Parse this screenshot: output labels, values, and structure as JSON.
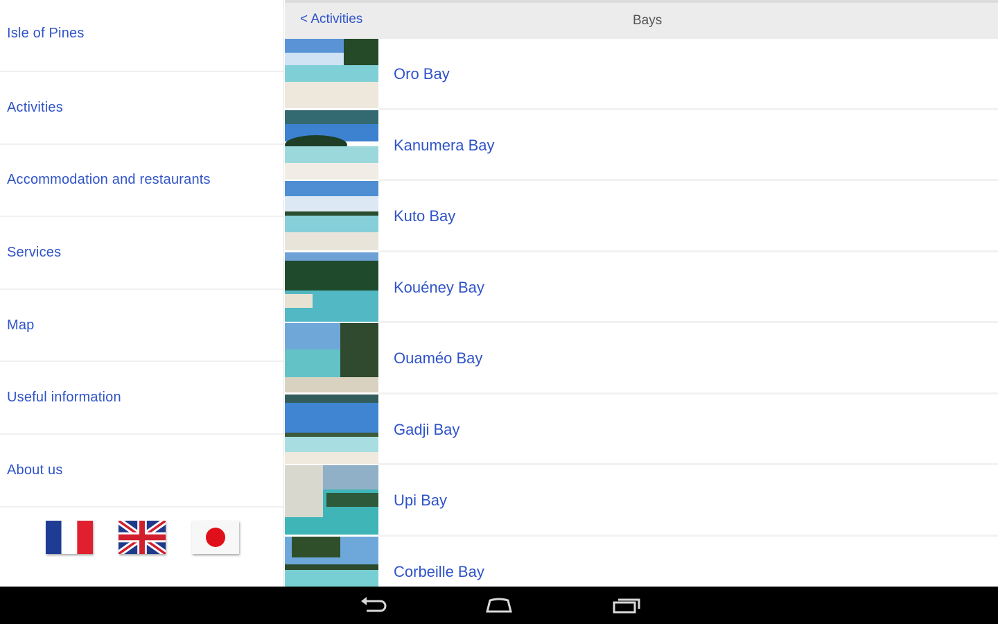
{
  "sidebar": {
    "items": [
      {
        "label": "Isle of Pines"
      },
      {
        "label": "Activities"
      },
      {
        "label": "Accommodation and restaurants"
      },
      {
        "label": "Services"
      },
      {
        "label": "Map"
      },
      {
        "label": "Useful information"
      },
      {
        "label": "About us"
      }
    ],
    "flags": [
      {
        "icon": "france-flag-icon"
      },
      {
        "icon": "uk-flag-icon"
      },
      {
        "icon": "japan-flag-icon"
      }
    ]
  },
  "header": {
    "back_label": "< Activities",
    "title": "Bays"
  },
  "bays": [
    {
      "name": "Oro Bay"
    },
    {
      "name": "Kanumera Bay"
    },
    {
      "name": "Kuto Bay"
    },
    {
      "name": "Kouéney Bay"
    },
    {
      "name": "Ouaméo Bay"
    },
    {
      "name": "Gadji Bay"
    },
    {
      "name": "Upi Bay"
    },
    {
      "name": "Corbeille Bay"
    }
  ],
  "navbar": {
    "buttons": [
      "back-icon",
      "home-icon",
      "recent-apps-icon"
    ]
  },
  "colors": {
    "link": "#2f53c8",
    "header_bg": "#ececec",
    "navbar_bg": "#000000"
  }
}
